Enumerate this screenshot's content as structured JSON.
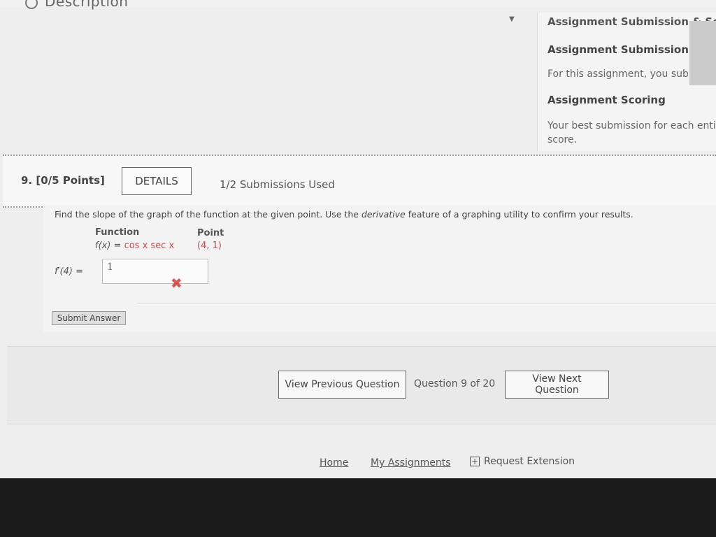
{
  "top": {
    "description_label": "Description"
  },
  "right_panel": {
    "cut_title": "Assignment Submission & Sc",
    "submission_heading": "Assignment Submission",
    "submission_text": "For this assignment, you submit answ",
    "scoring_heading": "Assignment Scoring",
    "scoring_text_line1": "Your best submission for each entire",
    "scoring_text_line2": "score."
  },
  "question": {
    "number_label": "9. [0/5 Points]",
    "details_label": "DETAILS",
    "submissions_used": "1/2 Submissions Used",
    "prompt_start": "Find the slope of the graph of the function at the given point. Use the ",
    "prompt_emph": "derivative",
    "prompt_end": " feature of a graphing utility to confirm your results.",
    "function_header": "Function",
    "point_header": "Point",
    "function_lhs": "f(x) = ",
    "function_expr": "cos x sec x",
    "point_value": "(4, 1)",
    "answer_label": "f′(4) =",
    "answer_value": "1",
    "result_mark": "✖",
    "submit_label": "Submit Answer"
  },
  "navigation": {
    "prev_label": "View Previous Question",
    "count_label": "Question 9 of 20",
    "next_label": "View Next Question"
  },
  "footer": {
    "home_label": "Home",
    "assignments_label": "My Assignments",
    "extension_label": "Request Extension"
  },
  "colors": {
    "error": "#d9534f",
    "math_red": "#c0504d"
  }
}
